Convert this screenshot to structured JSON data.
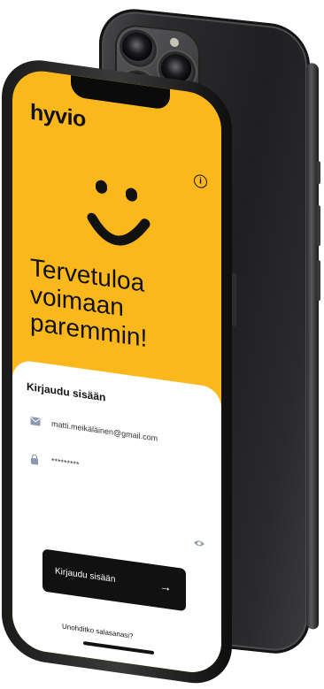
{
  "app": {
    "logo_text": "hyvio",
    "info_icon": "info-icon",
    "headline_lines": [
      "Tervetuloa",
      "voimaan",
      "paremmin!"
    ]
  },
  "login": {
    "title": "Kirjaudu sisään",
    "email_value": "matti.meikäläinen@gmail.com",
    "password_value": "*********",
    "button_label": "Kirjaudu sisään",
    "forgot_link": "Unohditko salasanasi?"
  },
  "colors": {
    "brand_yellow": "#fbb81c",
    "button_dark": "#111111",
    "frame": "#1a1a1a"
  }
}
